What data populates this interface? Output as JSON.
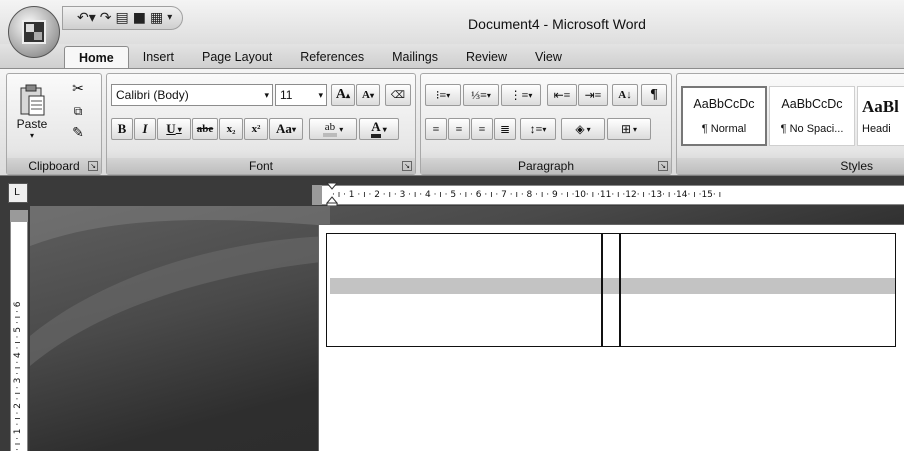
{
  "window": {
    "title": "Document4 - Microsoft Word"
  },
  "quick_access": {
    "undo_icon": "undo-icon",
    "redo_icon": "redo-icon",
    "save_icon": "save-icon"
  },
  "tabs": [
    {
      "label": "Home"
    },
    {
      "label": "Insert"
    },
    {
      "label": "Page Layout"
    },
    {
      "label": "References"
    },
    {
      "label": "Mailings"
    },
    {
      "label": "Review"
    },
    {
      "label": "View"
    }
  ],
  "clipboard": {
    "paste_label": "Paste",
    "group_label": "Clipboard"
  },
  "font": {
    "family": "Calibri (Body)",
    "size": "11",
    "grow": "A",
    "shrink": "A",
    "bold": "B",
    "italic": "I",
    "underline": "U",
    "strike": "abe",
    "subscript": "x₂",
    "superscript": "x²",
    "change_case": "Aa",
    "highlight": "ab",
    "font_color": "A",
    "group_label": "Font"
  },
  "paragraph": {
    "group_label": "Paragraph",
    "pilcrow": "¶"
  },
  "styles": {
    "group_label": "Styles",
    "items": [
      {
        "sample": "AaBbCcDc",
        "name": "¶ Normal"
      },
      {
        "sample": "AaBbCcDc",
        "name": "¶ No Spaci..."
      },
      {
        "sample": "AaBl",
        "name": "Headi"
      }
    ]
  },
  "ruler": {
    "horizontal": "· ı · 1 · ı · 2 · ı · 3 · ı · 4 · ı · 5 · ı · 6 · ı · 7 · ı · 8 · ı · 9 · ı ·10· ı ·11· ı ·12· ı ·13· ı ·14· ı ·15· ı",
    "vertical": "· ı · 1 · ı · 2 · ı · 3 · ı · 4 · ı · 5 · ı · 6",
    "tab_selector": "L"
  }
}
